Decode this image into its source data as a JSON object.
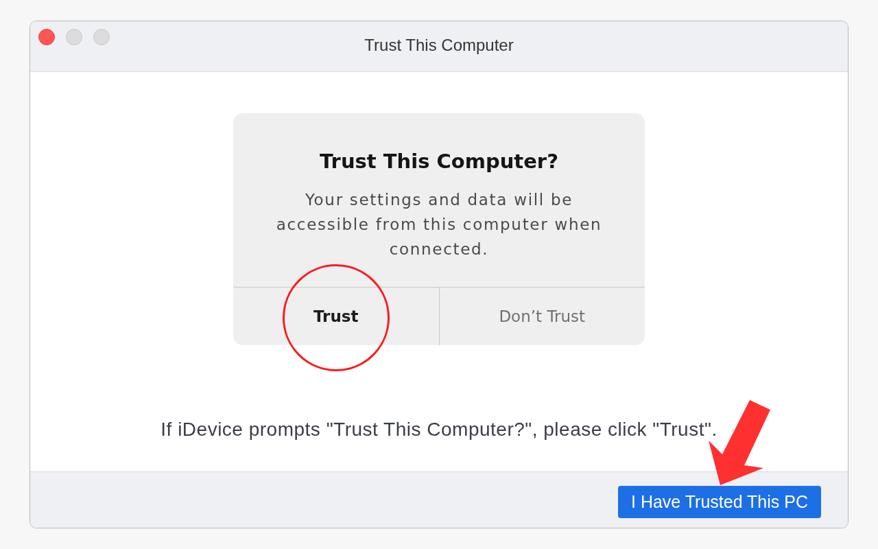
{
  "window": {
    "title": "Trust This Computer",
    "controls": [
      {
        "kind": "close",
        "enabled": true
      },
      {
        "kind": "minimize",
        "enabled": false
      },
      {
        "kind": "zoom",
        "enabled": false
      }
    ]
  },
  "prompt": {
    "title": "Trust This Computer?",
    "message": "Your settings and data will be accessible from this computer when connected.",
    "buttons": [
      {
        "label": "Trust",
        "emphasized": true
      },
      {
        "label": "Don’t Trust",
        "emphasized": false
      }
    ]
  },
  "instruction": "If iDevice prompts \"Trust This Computer?\", please click \"Trust\".",
  "footer": {
    "button": "I Have Trusted This PC"
  },
  "annotations": [
    {
      "kind": "circle"
    },
    {
      "kind": "arrow"
    }
  ]
}
